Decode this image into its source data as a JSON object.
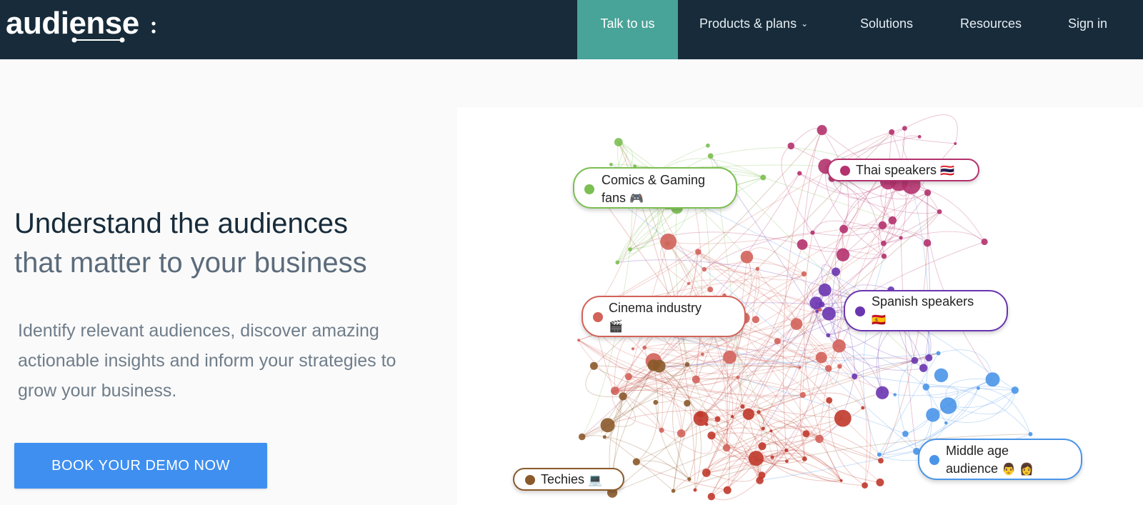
{
  "brand": {
    "logo_text": "audiense"
  },
  "nav": {
    "talk": "Talk to us",
    "products": "Products & plans",
    "solutions": "Solutions",
    "resources": "Resources",
    "signin": "Sign in"
  },
  "hero": {
    "headline": "Understand the audiences",
    "subheadline": "that matter to your business",
    "description": "Identify relevant audiences, discover amazing actionable insights and inform your strategies to grow your business.",
    "cta": "BOOK YOUR DEMO NOW"
  },
  "clusters": [
    {
      "line1": "Comics & Gaming",
      "line2": "fans",
      "emoji": "🎮",
      "color": "#7cbf52"
    },
    {
      "line1": "Thai speakers",
      "line2": "",
      "emoji": "🇹🇭",
      "color": "#b4326e"
    },
    {
      "line1": "Cinema industry",
      "line2": "",
      "emoji": "🎬",
      "color": "#d2625a"
    },
    {
      "line1": "Spanish speakers",
      "line2": "",
      "emoji": "🇪🇸",
      "color": "#6a35b0"
    },
    {
      "line1": "Middle age",
      "line2": "audience",
      "emoji": "👨 👩",
      "color": "#4a95e8"
    },
    {
      "line1": "Techies",
      "line2": "",
      "emoji": "💻",
      "color": "#8b5a2b"
    }
  ],
  "colors": {
    "header": "#172b3a",
    "talk_bg": "#48a398",
    "cta": "#3f8ff0",
    "heading": "#172b3a",
    "muted": "#5b6b7b"
  },
  "icons": {
    "products_chevron": "chevron-down-icon"
  }
}
